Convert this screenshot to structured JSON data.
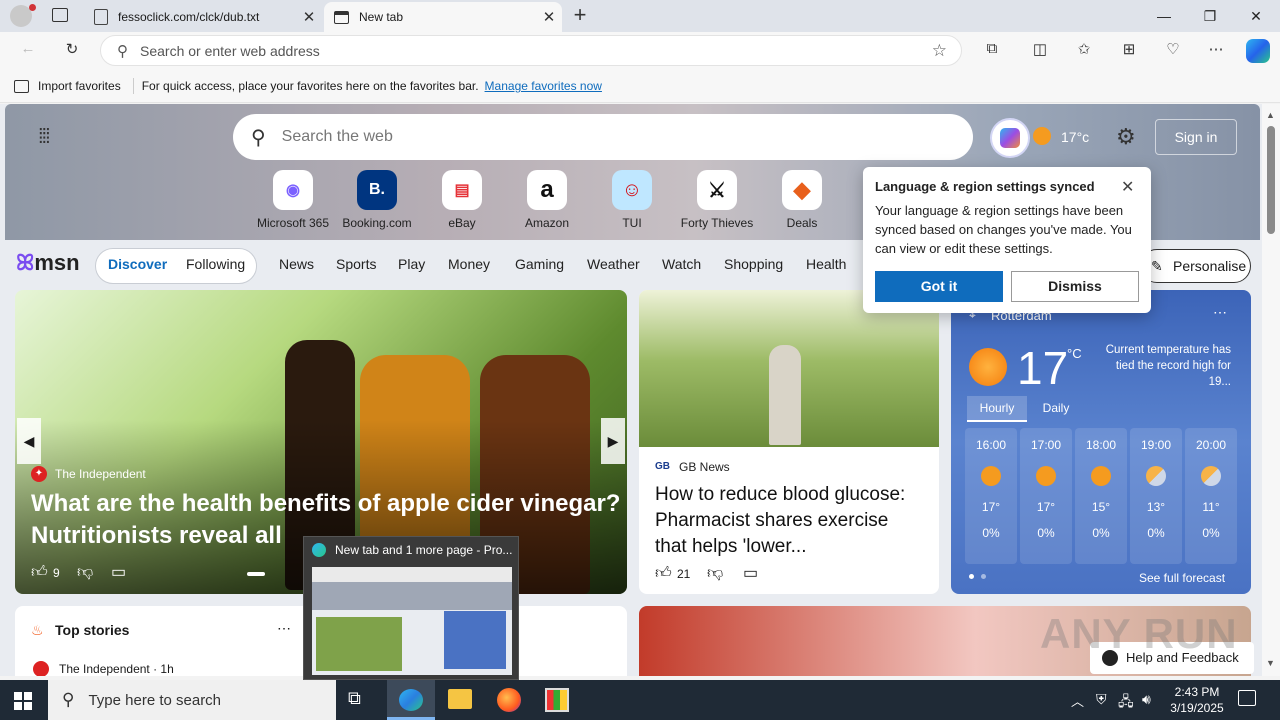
{
  "browser": {
    "tabs": [
      {
        "label": "fessoclick.com/clck/dub.txt"
      },
      {
        "label": "New tab"
      }
    ],
    "address_placeholder": "Search or enter web address",
    "favorites_bar": {
      "import_label": "Import favorites",
      "hint": "For quick access, place your favorites here on the favorites bar.",
      "manage_link": "Manage favorites now"
    }
  },
  "newtab": {
    "search_placeholder": "Search the web",
    "weather_temp": "17°c",
    "sign_in": "Sign in",
    "quick_links": [
      {
        "label": "Microsoft 365",
        "icon": "microsoft365-icon",
        "glyph": "◉",
        "color": "#7b61ff"
      },
      {
        "label": "Booking.com",
        "icon": "booking-icon",
        "glyph": "B.",
        "color": "#003580"
      },
      {
        "label": "eBay",
        "icon": "ebay-icon",
        "glyph": "▤",
        "color": "#e53238"
      },
      {
        "label": "Amazon",
        "icon": "amazon-icon",
        "glyph": "a",
        "color": "#111111"
      },
      {
        "label": "TUI",
        "icon": "tui-icon",
        "glyph": "☺",
        "color": "#d40e14"
      },
      {
        "label": "Forty Thieves",
        "icon": "forty-thieves-icon",
        "glyph": "⚔",
        "color": "#111111"
      },
      {
        "label": "Deals",
        "icon": "deals-icon",
        "glyph": "◆",
        "color": "#e8601c"
      }
    ]
  },
  "msn": {
    "logo": "msn",
    "tabs": [
      "Discover",
      "Following"
    ],
    "nav": [
      "News",
      "Sports",
      "Play",
      "Money",
      "Gaming",
      "Weather",
      "Watch",
      "Shopping",
      "Health"
    ],
    "personalise": "Personalise"
  },
  "popup": {
    "title": "Language & region settings synced",
    "body": "Your language & region settings have been synced based on changes you've made. You can view or edit these settings.",
    "primary": "Got it",
    "secondary": "Dismiss"
  },
  "hero_card": {
    "source": "The Independent",
    "headline": "What are the health benefits of apple cider vinegar? Nutritionists reveal all",
    "likes": "9"
  },
  "gb_card": {
    "source": "GB News",
    "headline": "How to reduce blood glucose: Pharmacist shares exercise that helps 'lower...",
    "likes": "21"
  },
  "weather": {
    "city": "Rotterdam",
    "temp": "17",
    "unit": "°C",
    "note": "Current temperature has tied the record high for 19...",
    "tabs": [
      "Hourly",
      "Daily"
    ],
    "hours": [
      {
        "time": "16:00",
        "temp": "17°",
        "rain": "0%",
        "icon": "sun"
      },
      {
        "time": "17:00",
        "temp": "17°",
        "rain": "0%",
        "icon": "sun"
      },
      {
        "time": "18:00",
        "temp": "15°",
        "rain": "0%",
        "icon": "sun"
      },
      {
        "time": "19:00",
        "temp": "13°",
        "rain": "0%",
        "icon": "moon-cloud"
      },
      {
        "time": "20:00",
        "temp": "11°",
        "rain": "0%",
        "icon": "moon-cloud"
      }
    ],
    "forecast_link": "See full forecast"
  },
  "top_stories": {
    "title": "Top stories",
    "source": "The Independent · 1h"
  },
  "thumbnail": {
    "title": "New tab and 1 more page - Pro..."
  },
  "feedback": "Help and Feedback",
  "watermark": "ANY RUN",
  "taskbar": {
    "search_placeholder": "Type here to search",
    "time": "2:43 PM",
    "date": "3/19/2025"
  }
}
